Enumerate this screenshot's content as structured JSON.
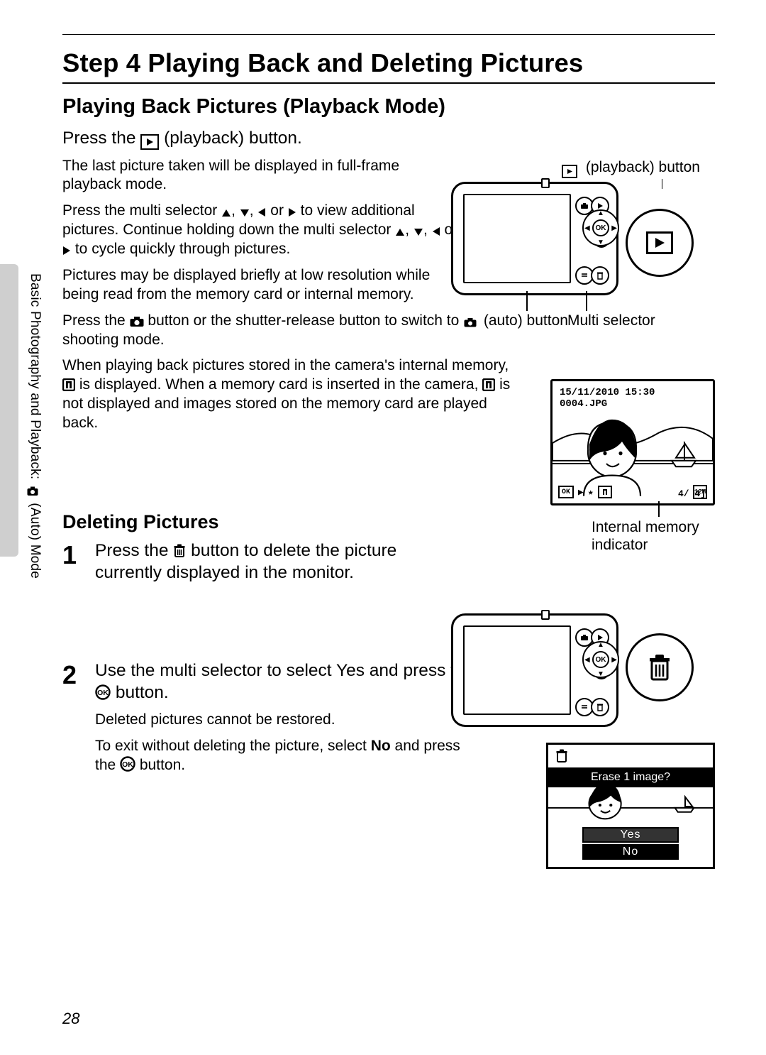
{
  "side_label_prefix": "Basic Photography and Playback: ",
  "side_label_suffix": " (Auto) Mode",
  "step_heading": "Step 4 Playing Back and Deleting Pictures",
  "section1_heading": "Playing Back Pictures (Playback Mode)",
  "press_playback_prefix": "Press the ",
  "press_playback_suffix": " (playback) button.",
  "p_fullframe": "The last picture taken will be displayed in full-frame playback mode.",
  "p_multi_prefix": "Press the multi selector ",
  "p_multi_mid1": ", ",
  "p_multi_mid2": ", ",
  "p_multi_mid3": " or ",
  "p_multi_after1": " to view additional pictures. Continue holding down the multi selector ",
  "p_multi_after2": " to cycle quickly through pictures.",
  "p_lowres": "Pictures may be displayed briefly at low resolution while being read from the memory card or internal memory.",
  "p_shoot_prefix": "Press the ",
  "p_shoot_suffix": " button or the shutter-release button to switch to shooting mode.",
  "p_internal_prefix": "When playing back pictures stored in the camera's internal memory, ",
  "p_internal_mid": " is displayed. When a memory card is inserted in the camera, ",
  "p_internal_suffix": " is not displayed and images stored on the memory card are played back.",
  "dlabel_playback": " (playback) button",
  "dlabel_auto": " (auto) button",
  "dlabel_multi": "Multi selector",
  "sample_date": "15/11/2010 15:30",
  "sample_file": "0004.JPG",
  "sample_ok": "OK",
  "sample_size": "12M",
  "sample_count": "4/   4]",
  "sample_caption": "Internal memory indicator",
  "section2_heading": "Deleting Pictures",
  "step1_num": "1",
  "step1_prefix": "Press the ",
  "step1_suffix": " button to delete the picture currently displayed in the monitor.",
  "step2_num": "2",
  "step2_prefix": "Use the multi selector to select ",
  "step2_bold": "Yes",
  "step2_mid": " and press the ",
  "step2_suffix": " button.",
  "p_cannot": "Deleted pictures cannot be restored.",
  "p_exit_prefix": "To exit without deleting the picture, select ",
  "p_exit_bold": "No",
  "p_exit_mid": " and press the ",
  "p_exit_suffix": " button.",
  "confirm_title": "Erase 1 image?",
  "confirm_yes": "Yes",
  "confirm_no": "No",
  "page_number": "28"
}
